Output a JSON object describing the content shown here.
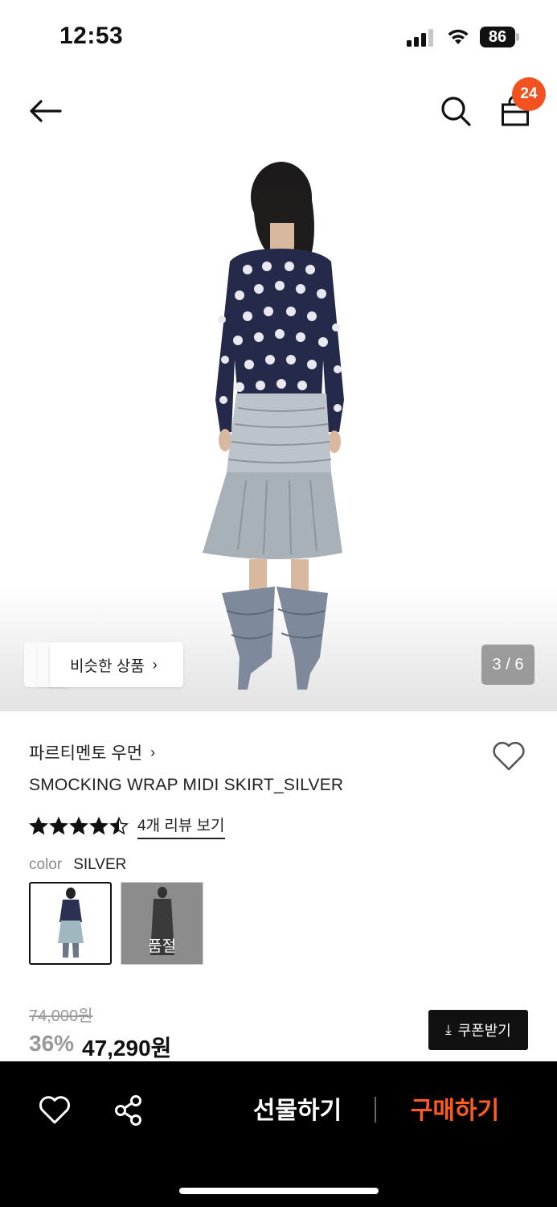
{
  "status_bar": {
    "time": "12:53",
    "battery": "86"
  },
  "header": {
    "cart_count": "24"
  },
  "hero": {
    "similar_label": "비슷한 상품",
    "page_counter": "3 / 6"
  },
  "product": {
    "brand": "파르티멘토 우먼",
    "title": "SMOCKING WRAP MIDI SKIRT_SILVER",
    "rating": 4.5,
    "rating_max": 5,
    "review_link": "4개 리뷰 보기",
    "color_label": "color",
    "color_value": "SILVER",
    "swatches": [
      {
        "name": "SILVER",
        "selected": true
      },
      {
        "name": "",
        "status": "품절"
      }
    ],
    "original_price": "74,000원",
    "discount_rate": "36%",
    "sale_price": "47,290원",
    "coupon_label": "쿠폰받기"
  },
  "bottom_bar": {
    "gift_label": "선물하기",
    "buy_label": "구매하기"
  },
  "colors": {
    "accent": "#f2521f",
    "buy": "#ff5a1f",
    "bar": "#000000"
  }
}
